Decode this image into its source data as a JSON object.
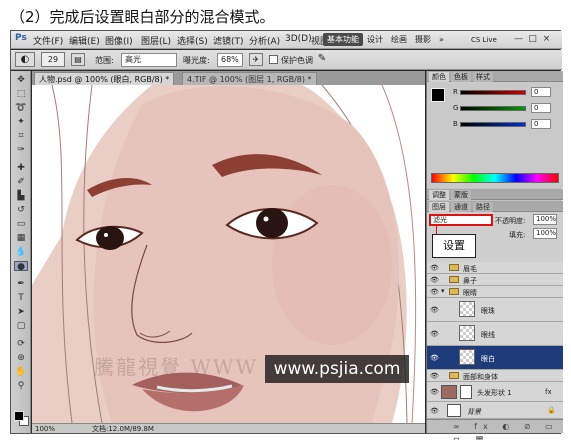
{
  "caption": "（2）完成后设置眼白部分的混合模式。",
  "menubar": {
    "logo": "Ps",
    "items": [
      "文件(F)",
      "编辑(E)",
      "图像(I)",
      "图层(L)",
      "选择(S)",
      "滤镜(T)",
      "分析(A)",
      "3D(D)",
      "视图(V)",
      "窗口(W)",
      "帮助(H)"
    ],
    "workspaces": [
      "基本功能",
      "设计",
      "绘画",
      "摄影",
      "»"
    ],
    "cs_live": "CS Live",
    "window_controls": [
      "—",
      "□",
      "×"
    ]
  },
  "options": {
    "brush_size": "29",
    "range_label": "范围:",
    "range_value": "高光",
    "exposure_label": "曝光度:",
    "exposure_value": "68%",
    "protect_tones_label": "保护色调"
  },
  "tabs": [
    {
      "label": "人物.psd @ 100% (眼白, RGB/8) *",
      "active": true
    },
    {
      "label": "4.TIF @ 100% (图层 1, RGB/8) *",
      "active": false
    }
  ],
  "canvas": {
    "watermark_url": "www.psjia.com",
    "watermark_cn": "騰龍視覺 WWW"
  },
  "status": {
    "zoom": "100%",
    "doc_info": "文档:12.0M/89.8M"
  },
  "color_panel": {
    "tabs": [
      "颜色",
      "色板",
      "样式"
    ],
    "channels": [
      {
        "label": "R",
        "value": "0",
        "color": "#d40000"
      },
      {
        "label": "G",
        "value": "0",
        "color": "#00a000"
      },
      {
        "label": "B",
        "value": "0",
        "color": "#0030d0"
      }
    ]
  },
  "adjust_panel": {
    "tabs": [
      "调整",
      "蒙版"
    ]
  },
  "layers_panel": {
    "tabs": [
      "图层",
      "通道",
      "路径"
    ],
    "blend_mode": "滤光",
    "opacity_label": "不透明度:",
    "opacity_value": "100%",
    "fill_label": "填充:",
    "fill_value": "100%",
    "callout": "设置",
    "layers": [
      {
        "name": "眉毛",
        "type": "folder",
        "indent": 0,
        "selected": false
      },
      {
        "name": "鼻子",
        "type": "folder",
        "indent": 0,
        "selected": false
      },
      {
        "name": "眼睛",
        "type": "folder-open",
        "indent": 0,
        "selected": false
      },
      {
        "name": "眼珠",
        "type": "layer",
        "indent": 1,
        "selected": false
      },
      {
        "name": "眼线",
        "type": "layer",
        "indent": 1,
        "selected": false
      },
      {
        "name": "眼白",
        "type": "layer",
        "indent": 1,
        "selected": true
      },
      {
        "name": "面部和身体",
        "type": "folder",
        "indent": 0,
        "selected": false
      },
      {
        "name": "头发形状 1",
        "type": "shape",
        "indent": 0,
        "selected": false
      },
      {
        "name": "背景",
        "type": "background",
        "indent": 0,
        "selected": false
      }
    ],
    "footer_icons": "∞ fx ◐ ⊘ ▭ ⊡ 🗑"
  },
  "colors": {
    "skin": "#eacdc5",
    "lips": "#b56f6a",
    "brow": "#8d3f33",
    "selection": "#1e3b7a",
    "callout_border": "#d11111"
  }
}
